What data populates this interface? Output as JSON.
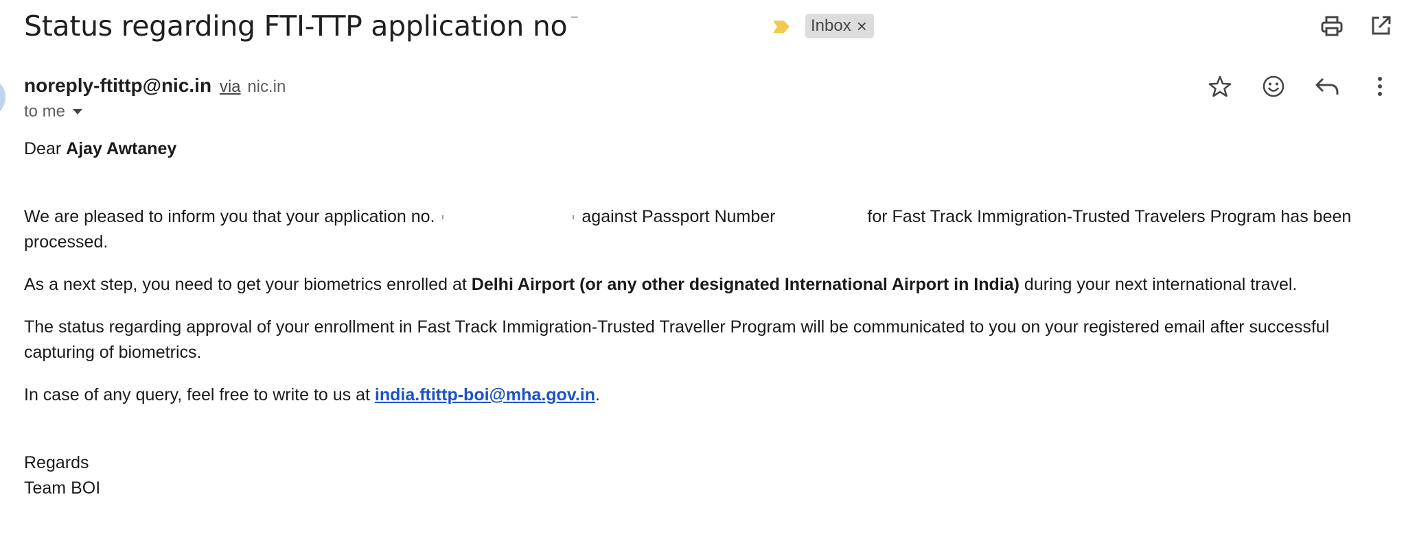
{
  "email": {
    "subject": "Status regarding FTI-TTP application no",
    "label": "Inbox",
    "sender_name": "noreply-ftittp@nic.in",
    "sender_via": "via",
    "sender_domain": "nic.in",
    "recipient": "to me",
    "body": {
      "greeting": "Dear",
      "recipient_name": "Ajay Awtaney",
      "para1_a": "We are pleased to inform you that your application no.",
      "para1_b": "against Passport Number",
      "para1_c": "for Fast Track Immigration-Trusted Travelers Program has been processed.",
      "para2_a": "As a next step, you need to get your biometrics enrolled at",
      "para2_bold": "Delhi Airport (or any other designated International Airport in India)",
      "para2_c": "during your next international travel.",
      "para3": "The status regarding approval of your enrollment in Fast Track Immigration-Trusted Traveller Program will be communicated to you on your registered email after successful capturing of biometrics.",
      "para4_a": "In case of any query, feel free to write to us at",
      "para4_link": "india.ftittp-boi@mha.gov.in",
      "para4_end": ".",
      "signoff": "Regards",
      "signature": "Team BOI"
    }
  },
  "icons": {
    "importance": "importance-marker-icon",
    "label_close": "close-icon",
    "print": "print-icon",
    "open_new_window": "open-in-new-window-icon",
    "star": "star-icon",
    "emoji": "emoji-reaction-icon",
    "reply": "reply-icon",
    "more": "more-vert-icon",
    "recipient_dropdown": "chevron-down-icon"
  },
  "colors": {
    "importance": "#f2c94c",
    "link": "#1a53c5",
    "label_chip": "#dddddd",
    "icon": "#444746"
  }
}
